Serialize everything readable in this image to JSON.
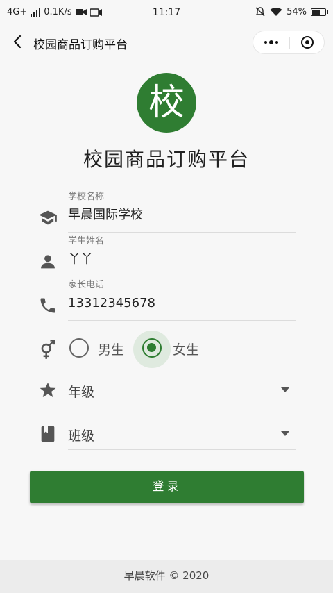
{
  "status_bar": {
    "network": "4G+",
    "speed": "0.1K/s",
    "time": "11:17",
    "battery": "54%"
  },
  "nav": {
    "title": "校园商品订购平台"
  },
  "logo": {
    "char": "校",
    "color": "#2f7d32"
  },
  "app_title": "校园商品订购平台",
  "form": {
    "school": {
      "label": "学校名称",
      "value": "早晨国际学校",
      "icon": "graduation-cap-icon"
    },
    "student": {
      "label": "学生姓名",
      "value": "丫丫",
      "icon": "person-icon"
    },
    "phone": {
      "label": "家长电话",
      "value": "13312345678",
      "icon": "phone-icon"
    },
    "gender": {
      "icon": "gender-icon",
      "options": [
        "男生",
        "女生"
      ],
      "selected": "女生"
    },
    "grade": {
      "value": "年级",
      "icon": "star-icon"
    },
    "class": {
      "value": "班级",
      "icon": "book-icon"
    }
  },
  "login_button": "登录",
  "footer": "早晨软件 © 2020"
}
